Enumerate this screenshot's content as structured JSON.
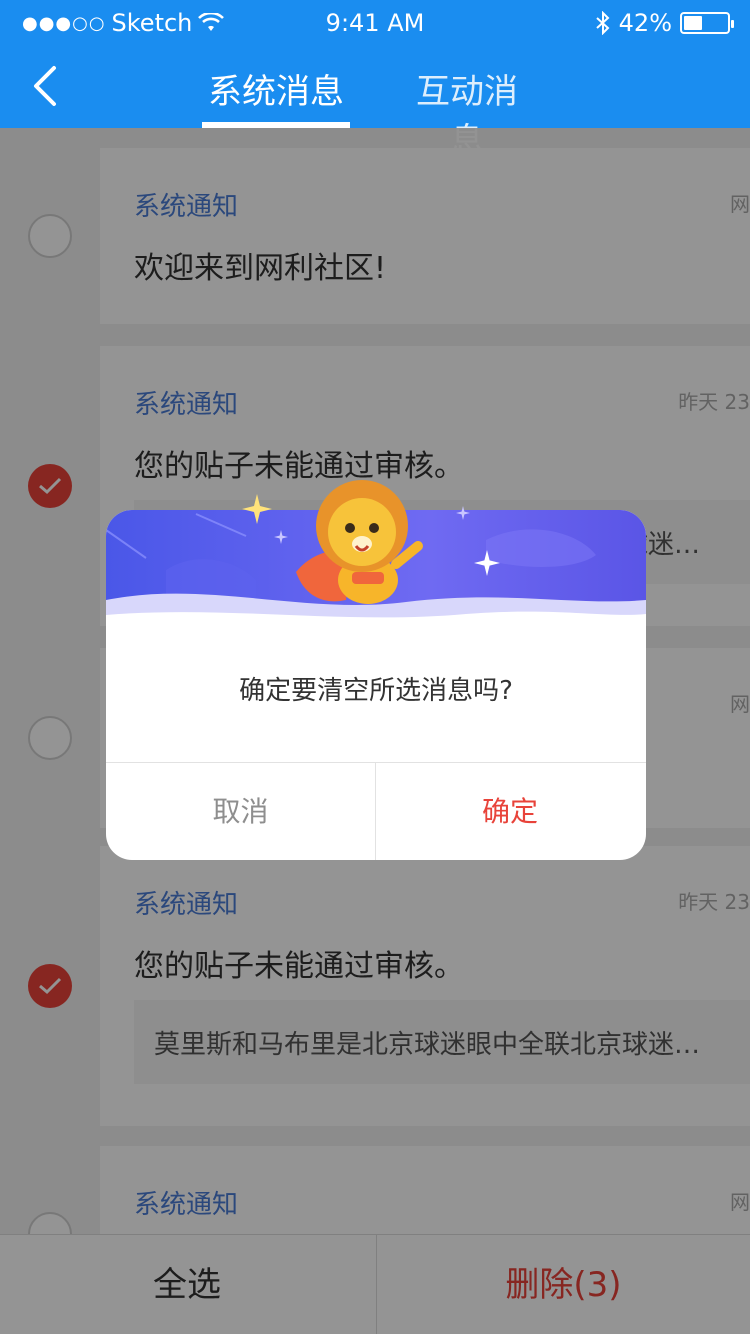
{
  "status_bar": {
    "carrier": "Sketch",
    "time": "9:41 AM",
    "battery_text": "42%",
    "battery_level": 0.42
  },
  "nav": {
    "tabs": [
      {
        "label": "系统消息",
        "active": true
      },
      {
        "label": "互动消息",
        "active": false
      }
    ]
  },
  "messages": [
    {
      "type": "系统通知",
      "time": "网",
      "text": "欢迎来到网利社区!",
      "checked": false
    },
    {
      "type": "系统通知",
      "time": "昨天 23",
      "text": "您的贴子未能通过审核。",
      "quote": "莫里斯和马布里是北京球迷眼中全联北京球迷…",
      "checked": true
    },
    {
      "type": "系统通知",
      "time": "网",
      "checked": false
    },
    {
      "type": "系统通知",
      "time": "昨天 23",
      "text": "您的贴子未能通过审核。",
      "quote": "莫里斯和马布里是北京球迷眼中全联北京球迷…",
      "checked": true
    },
    {
      "type": "系统通知",
      "time": "网",
      "checked": false
    }
  ],
  "bottom_bar": {
    "select_all": "全选",
    "delete": "删除(3)"
  },
  "dialog": {
    "message": "确定要清空所选消息吗?",
    "cancel": "取消",
    "confirm": "确定"
  },
  "colors": {
    "nav_blue": "#1a8df0",
    "accent_red": "#e8433a",
    "type_blue": "#4a7cd6"
  }
}
